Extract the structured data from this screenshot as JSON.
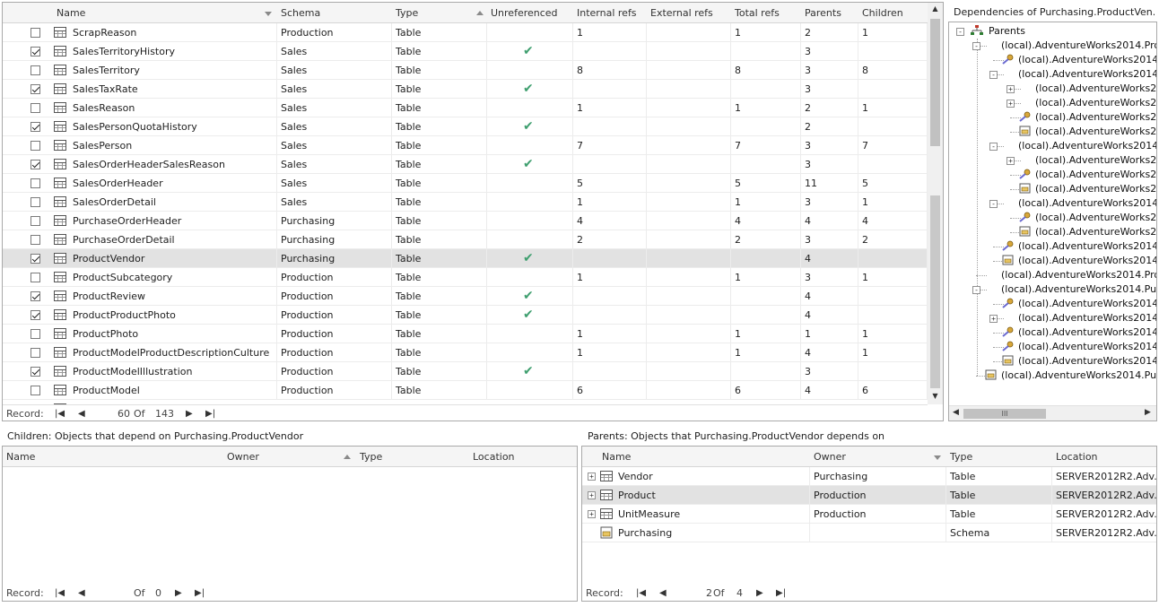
{
  "main_grid": {
    "columns": [
      "Name",
      "Schema",
      "Type",
      "Unreferenced",
      "Internal refs",
      "External refs",
      "Total refs",
      "Parents",
      "Children"
    ],
    "rows": [
      {
        "checked": false,
        "name": "ScrapReason",
        "schema": "Production",
        "type": "Table",
        "unref": false,
        "internal": "1",
        "external": "",
        "total": "1",
        "parents": "2",
        "children": "1"
      },
      {
        "checked": true,
        "name": "SalesTerritoryHistory",
        "schema": "Sales",
        "type": "Table",
        "unref": true,
        "internal": "",
        "external": "",
        "total": "",
        "parents": "3",
        "children": ""
      },
      {
        "checked": false,
        "name": "SalesTerritory",
        "schema": "Sales",
        "type": "Table",
        "unref": false,
        "internal": "8",
        "external": "",
        "total": "8",
        "parents": "3",
        "children": "8"
      },
      {
        "checked": true,
        "name": "SalesTaxRate",
        "schema": "Sales",
        "type": "Table",
        "unref": true,
        "internal": "",
        "external": "",
        "total": "",
        "parents": "3",
        "children": ""
      },
      {
        "checked": false,
        "name": "SalesReason",
        "schema": "Sales",
        "type": "Table",
        "unref": false,
        "internal": "1",
        "external": "",
        "total": "1",
        "parents": "2",
        "children": "1"
      },
      {
        "checked": true,
        "name": "SalesPersonQuotaHistory",
        "schema": "Sales",
        "type": "Table",
        "unref": true,
        "internal": "",
        "external": "",
        "total": "",
        "parents": "2",
        "children": ""
      },
      {
        "checked": false,
        "name": "SalesPerson",
        "schema": "Sales",
        "type": "Table",
        "unref": false,
        "internal": "7",
        "external": "",
        "total": "7",
        "parents": "3",
        "children": "7"
      },
      {
        "checked": true,
        "name": "SalesOrderHeaderSalesReason",
        "schema": "Sales",
        "type": "Table",
        "unref": true,
        "internal": "",
        "external": "",
        "total": "",
        "parents": "3",
        "children": ""
      },
      {
        "checked": false,
        "name": "SalesOrderHeader",
        "schema": "Sales",
        "type": "Table",
        "unref": false,
        "internal": "5",
        "external": "",
        "total": "5",
        "parents": "11",
        "children": "5"
      },
      {
        "checked": false,
        "name": "SalesOrderDetail",
        "schema": "Sales",
        "type": "Table",
        "unref": false,
        "internal": "1",
        "external": "",
        "total": "1",
        "parents": "3",
        "children": "1"
      },
      {
        "checked": false,
        "name": "PurchaseOrderHeader",
        "schema": "Purchasing",
        "type": "Table",
        "unref": false,
        "internal": "4",
        "external": "",
        "total": "4",
        "parents": "4",
        "children": "4"
      },
      {
        "checked": false,
        "name": "PurchaseOrderDetail",
        "schema": "Purchasing",
        "type": "Table",
        "unref": false,
        "internal": "2",
        "external": "",
        "total": "2",
        "parents": "3",
        "children": "2"
      },
      {
        "checked": true,
        "name": "ProductVendor",
        "schema": "Purchasing",
        "type": "Table",
        "unref": true,
        "internal": "",
        "external": "",
        "total": "",
        "parents": "4",
        "children": "",
        "selected": true
      },
      {
        "checked": false,
        "name": "ProductSubcategory",
        "schema": "Production",
        "type": "Table",
        "unref": false,
        "internal": "1",
        "external": "",
        "total": "1",
        "parents": "3",
        "children": "1"
      },
      {
        "checked": true,
        "name": "ProductReview",
        "schema": "Production",
        "type": "Table",
        "unref": true,
        "internal": "",
        "external": "",
        "total": "",
        "parents": "4",
        "children": ""
      },
      {
        "checked": true,
        "name": "ProductProductPhoto",
        "schema": "Production",
        "type": "Table",
        "unref": true,
        "internal": "",
        "external": "",
        "total": "",
        "parents": "4",
        "children": ""
      },
      {
        "checked": false,
        "name": "ProductPhoto",
        "schema": "Production",
        "type": "Table",
        "unref": false,
        "internal": "1",
        "external": "",
        "total": "1",
        "parents": "1",
        "children": "1"
      },
      {
        "checked": false,
        "name": "ProductModelProductDescriptionCulture",
        "schema": "Production",
        "type": "Table",
        "unref": false,
        "internal": "1",
        "external": "",
        "total": "1",
        "parents": "4",
        "children": "1"
      },
      {
        "checked": true,
        "name": "ProductModelIllustration",
        "schema": "Production",
        "type": "Table",
        "unref": true,
        "internal": "",
        "external": "",
        "total": "",
        "parents": "3",
        "children": ""
      },
      {
        "checked": false,
        "name": "ProductModel",
        "schema": "Production",
        "type": "Table",
        "unref": false,
        "internal": "6",
        "external": "",
        "total": "6",
        "parents": "4",
        "children": "6"
      }
    ],
    "record_label": "Record:",
    "record_current": "60",
    "record_of": "Of",
    "record_total": "143"
  },
  "dependencies_tree": {
    "title": "Dependencies of Purchasing.ProductVen...",
    "root_label": "Parents",
    "nodes": [
      {
        "level": 1,
        "expander": "-",
        "icon": "table",
        "label": "(local).AdventureWorks2014.Proc"
      },
      {
        "level": 2,
        "expander": "",
        "icon": "key",
        "label": "(local).AdventureWorks2014.F"
      },
      {
        "level": 2,
        "expander": "-",
        "icon": "table",
        "label": "(local).AdventureWorks2014.F"
      },
      {
        "level": 3,
        "expander": "+",
        "icon": "table",
        "label": "(local).AdventureWorks20"
      },
      {
        "level": 3,
        "expander": "+",
        "icon": "table",
        "label": "(local).AdventureWorks20"
      },
      {
        "level": 3,
        "expander": "",
        "icon": "key",
        "label": "(local).AdventureWorks20"
      },
      {
        "level": 3,
        "expander": "",
        "icon": "schema",
        "label": "(local).AdventureWorks20"
      },
      {
        "level": 2,
        "expander": "-",
        "icon": "table",
        "label": "(local).AdventureWorks2014.F"
      },
      {
        "level": 3,
        "expander": "+",
        "icon": "table",
        "label": "(local).AdventureWorks20"
      },
      {
        "level": 3,
        "expander": "",
        "icon": "key",
        "label": "(local).AdventureWorks20"
      },
      {
        "level": 3,
        "expander": "",
        "icon": "schema",
        "label": "(local).AdventureWorks20"
      },
      {
        "level": 2,
        "expander": "-",
        "icon": "table",
        "label": "(local).AdventureWorks2014.F"
      },
      {
        "level": 3,
        "expander": "",
        "icon": "key",
        "label": "(local).AdventureWorks20"
      },
      {
        "level": 3,
        "expander": "",
        "icon": "schema",
        "label": "(local).AdventureWorks20"
      },
      {
        "level": 2,
        "expander": "",
        "icon": "key",
        "label": "(local).AdventureWorks2014.N"
      },
      {
        "level": 2,
        "expander": "",
        "icon": "schema",
        "label": "(local).AdventureWorks2014.F"
      },
      {
        "level": 1,
        "expander": "",
        "icon": "table",
        "label": "(local).AdventureWorks2014.Proc"
      },
      {
        "level": 1,
        "expander": "-",
        "icon": "table",
        "label": "(local).AdventureWorks2014.Purc"
      },
      {
        "level": 2,
        "expander": "",
        "icon": "key",
        "label": "(local).AdventureWorks2014.F"
      },
      {
        "level": 2,
        "expander": "+",
        "icon": "table",
        "label": "(local).AdventureWorks2014.F"
      },
      {
        "level": 2,
        "expander": "",
        "icon": "key",
        "label": "(local).AdventureWorks2014.F"
      },
      {
        "level": 2,
        "expander": "",
        "icon": "key",
        "label": "(local).AdventureWorks2014.N"
      },
      {
        "level": 2,
        "expander": "",
        "icon": "schema",
        "label": "(local).AdventureWorks2014.F"
      },
      {
        "level": 1,
        "expander": "",
        "icon": "schema",
        "label": "(local).AdventureWorks2014.Purc"
      }
    ],
    "hscroll_grip": "III"
  },
  "children_panel": {
    "caption": "Children: Objects that depend on Purchasing.ProductVendor",
    "columns": [
      "Name",
      "Owner",
      "Type",
      "Location"
    ],
    "record_label": "Record:",
    "record_current": "",
    "record_of": "Of",
    "record_total": "0"
  },
  "parents_panel": {
    "caption": "Parents: Objects that Purchasing.ProductVendor depends on",
    "columns": [
      "Name",
      "Owner",
      "Type",
      "Location"
    ],
    "rows": [
      {
        "expander": "+",
        "icon": "table",
        "name": "Vendor",
        "owner": "Purchasing",
        "type": "Table",
        "location": "SERVER2012R2.Adv..."
      },
      {
        "expander": "+",
        "icon": "table",
        "name": "Product",
        "owner": "Production",
        "type": "Table",
        "location": "SERVER2012R2.Adv...",
        "selected": true
      },
      {
        "expander": "+",
        "icon": "table",
        "name": "UnitMeasure",
        "owner": "Production",
        "type": "Table",
        "location": "SERVER2012R2.Adv..."
      },
      {
        "expander": "",
        "icon": "schema",
        "name": "Purchasing",
        "owner": "",
        "type": "Schema",
        "location": "SERVER2012R2.Adv..."
      }
    ],
    "record_label": "Record:",
    "record_current": "2",
    "record_of": "Of",
    "record_total": "4"
  },
  "colors": {
    "checkmark": "#3f9f6f",
    "selected_row": "#e2e2e2",
    "border": "#a9a9a9"
  }
}
